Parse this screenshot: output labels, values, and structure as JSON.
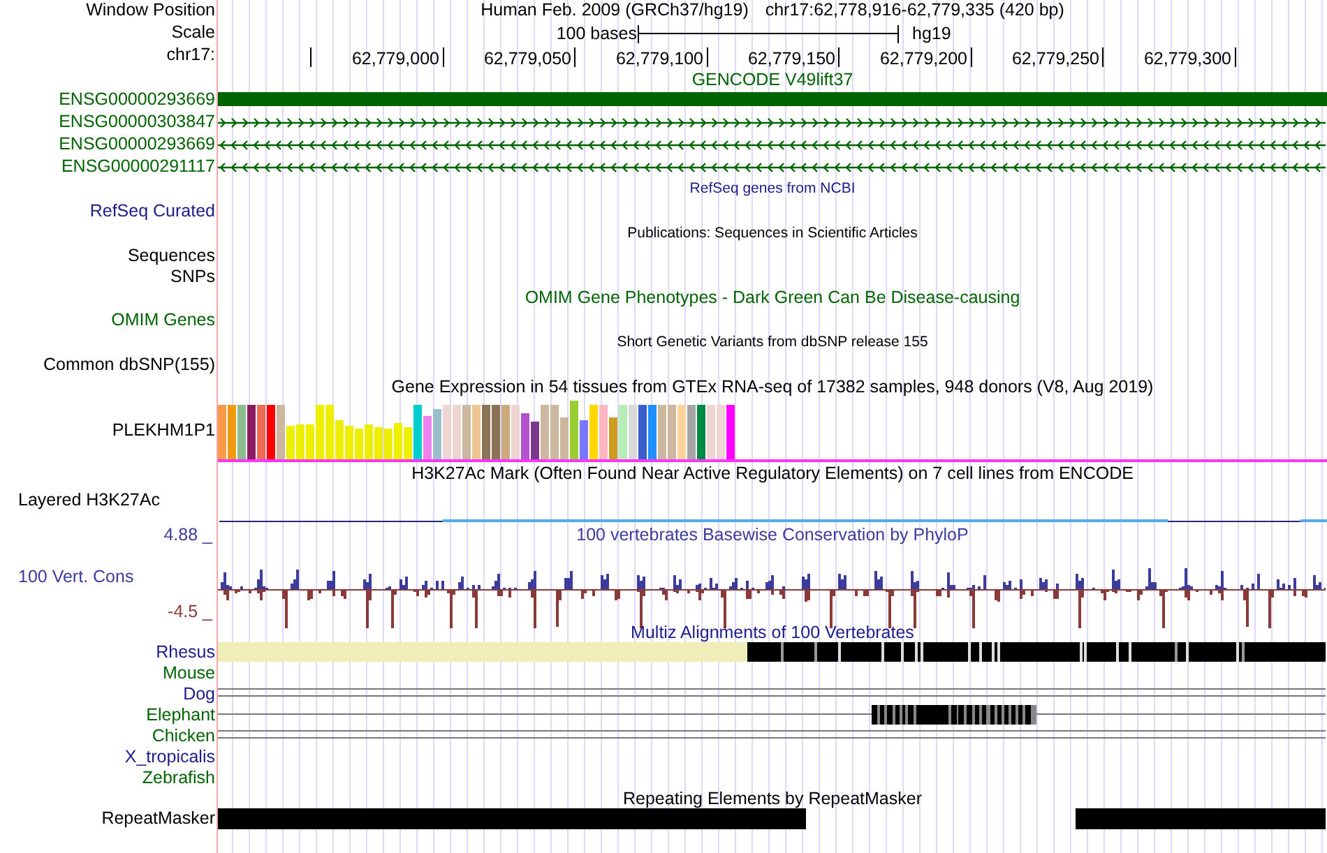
{
  "header": {
    "label": "Window Position",
    "title": "Human Feb. 2009 (GRCh37/hg19)",
    "position": "chr17:62,778,916-62,779,335 (420 bp)"
  },
  "scale": {
    "label": "Scale",
    "length": "100 bases",
    "assembly": "hg19"
  },
  "ruler": {
    "label": "chr17:",
    "ticks": [
      "62,779,000",
      "62,779,050",
      "62,779,100",
      "62,779,150",
      "62,779,200",
      "62,779,250",
      "62,779,300"
    ]
  },
  "tracks": [
    {
      "kind": "genes",
      "title": "GENCODE V49lift37",
      "color": "#006400",
      "items": [
        {
          "name": "ENSG00000293669",
          "kind": "block"
        },
        {
          "name": "ENSG00000303847",
          "kind": "forward"
        },
        {
          "name": "ENSG00000293669",
          "kind": "reverse"
        },
        {
          "name": "ENSG00000291117",
          "kind": "reverse"
        }
      ]
    },
    {
      "kind": "dense",
      "title": "RefSeq genes from NCBI",
      "color": "#1c1c8c",
      "labels": [
        "RefSeq Curated"
      ]
    },
    {
      "kind": "dense",
      "title": "Publications: Sequences in Scientific Articles",
      "color": "#000000",
      "labels": [
        "Sequences",
        "SNPs"
      ]
    },
    {
      "kind": "empty",
      "title": "OMIM Gene Phenotypes - Dark Green Can Be Disease-causing",
      "color": "#006400",
      "labels": [
        "OMIM Genes"
      ]
    },
    {
      "kind": "dense",
      "title": "Short Genetic Variants from dbSNP release 155",
      "color": "#000000",
      "labels": [
        "Common dbSNP(155)"
      ]
    },
    {
      "kind": "expression",
      "title": "Gene Expression in 54 tissues from GTEx RNA-seq of 17382 samples, 948 donors (V8, Aug 2019)",
      "color": "#000000",
      "labels": [
        "PLEKHM1P1"
      ]
    },
    {
      "kind": "signal",
      "title": "H3K27Ac Mark (Often Found Near Active Regulatory Elements) on 7 cell lines from ENCODE",
      "color": "#000000",
      "labels": [
        "Layered H3K27Ac"
      ]
    },
    {
      "kind": "conservation",
      "title": "100 vertebrates Basewise Conservation by PhyloP",
      "color": "#3c3c9c",
      "labels": [
        "100 Vert. Cons"
      ],
      "max": "4.88 _",
      "min": "-4.5 _"
    },
    {
      "kind": "alignment",
      "title": "Multiz Alignments of 100 Vertebrates",
      "color": "#1c1c8c",
      "species": [
        {
          "name": "Rhesus",
          "color": "#1c1c8c",
          "kind": "blocks"
        },
        {
          "name": "Mouse",
          "color": "#006400",
          "kind": "none"
        },
        {
          "name": "Dog",
          "color": "#1c1c8c",
          "kind": "double-line"
        },
        {
          "name": "Elephant",
          "color": "#006400",
          "kind": "line-blocks"
        },
        {
          "name": "Chicken",
          "color": "#006400",
          "kind": "double-line"
        },
        {
          "name": "X_tropicalis",
          "color": "#1c1c8c",
          "kind": "none"
        },
        {
          "name": "Zebrafish",
          "color": "#006400",
          "kind": "none"
        }
      ]
    },
    {
      "kind": "repeats",
      "title": "Repeating Elements by RepeatMasker",
      "color": "#000000",
      "labels": [
        "RepeatMasker"
      ]
    }
  ]
}
